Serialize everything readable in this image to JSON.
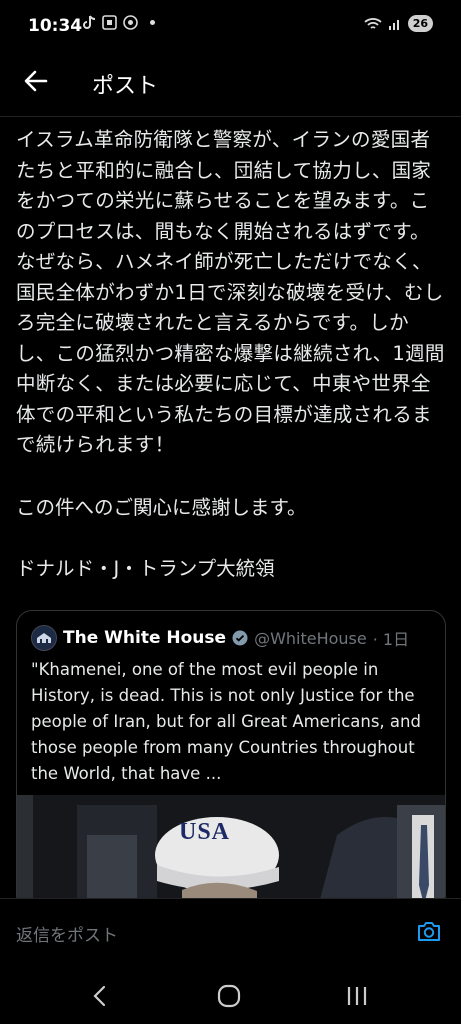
{
  "status_bar": {
    "time": "10:34",
    "icons_left": [
      "tiktok-icon",
      "screenshot-icon",
      "chrome-icon",
      "dot-icon"
    ],
    "icons_right": [
      "wifi-icon",
      "signal-icon"
    ],
    "battery": "26"
  },
  "header": {
    "title": "ポスト"
  },
  "post": {
    "body": "イスラム革命防衛隊と警察が、イランの愛国者たちと平和的に融合し、団結して協力し、国家をかつての栄光に蘇らせることを望みます。このプロセスは、間もなく開始されるはずです。なぜなら、ハメネイ師が死亡しただけでなく、国民全体がわずか1日で深刻な破壊を受け、むしろ完全に破壊されたと言えるからです。しかし、この猛烈かつ精密な爆撃は継続され、1週間中断なく、または必要に応じて、中東や世界全体での平和という私たちの目標が達成されるまで続けられます！",
    "thanks": "この件へのご関心に感謝します。",
    "signature": "ドナルド・J・トランプ大統領"
  },
  "quoted_post": {
    "name": "The White House",
    "handle": "@WhiteHouse",
    "time": "· 1日",
    "text": "\"Khamenei, one of the most evil people in History, is dead. This is not only Justice for the people of Iran, but for all Great Americans, and those people from many Countries throughout the World, that have ...",
    "image_caption_text": "USA"
  },
  "reply": {
    "placeholder": "返信をポスト"
  },
  "colors": {
    "background": "#000000",
    "text": "#e7e9ea",
    "muted": "#71767b",
    "accent": "#1d9bf0"
  }
}
